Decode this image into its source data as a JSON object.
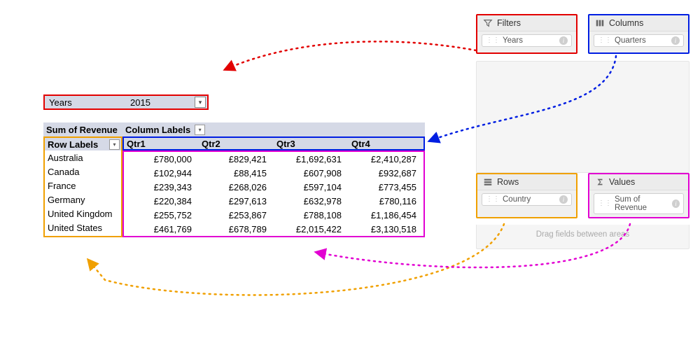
{
  "panels": {
    "filters": {
      "title": "Filters",
      "field": "Years"
    },
    "columns": {
      "title": "Columns",
      "field": "Quarters"
    },
    "rows": {
      "title": "Rows",
      "field": "Country"
    },
    "values": {
      "title": "Values",
      "field": "Sum of Revenue"
    },
    "hint": "Drag fields between areas"
  },
  "filter_bar": {
    "label": "Years",
    "value": "2015"
  },
  "pivot": {
    "measure_label": "Sum of Revenue",
    "col_labels_caption": "Column Labels",
    "row_labels_caption": "Row Labels",
    "columns": [
      "Qtr1",
      "Qtr2",
      "Qtr3",
      "Qtr4"
    ],
    "rows": [
      {
        "name": "Australia",
        "values": [
          "£780,000",
          "£829,421",
          "£1,692,631",
          "£2,410,287"
        ]
      },
      {
        "name": "Canada",
        "values": [
          "£102,944",
          "£88,415",
          "£607,908",
          "£932,687"
        ]
      },
      {
        "name": "France",
        "values": [
          "£239,343",
          "£268,026",
          "£597,104",
          "£773,455"
        ]
      },
      {
        "name": "Germany",
        "values": [
          "£220,384",
          "£297,613",
          "£632,978",
          "£780,116"
        ]
      },
      {
        "name": "United Kingdom",
        "values": [
          "£255,752",
          "£253,867",
          "£788,108",
          "£1,186,454"
        ]
      },
      {
        "name": "United States",
        "values": [
          "£461,769",
          "£678,789",
          "£2,015,422",
          "£3,130,518"
        ]
      }
    ]
  },
  "chart_data": {
    "type": "table",
    "title": "Sum of Revenue by Country and Quarter, 2015 (GBP)",
    "columns": [
      "Country",
      "Qtr1",
      "Qtr2",
      "Qtr3",
      "Qtr4"
    ],
    "rows": [
      [
        "Australia",
        780000,
        829421,
        1692631,
        2410287
      ],
      [
        "Canada",
        102944,
        88415,
        607908,
        932687
      ],
      [
        "France",
        239343,
        268026,
        597104,
        773455
      ],
      [
        "Germany",
        220384,
        297613,
        632978,
        780116
      ],
      [
        "United Kingdom",
        255752,
        253867,
        788108,
        1186454
      ],
      [
        "United States",
        461769,
        678789,
        2015422,
        3130518
      ]
    ],
    "filter": {
      "Years": 2015
    },
    "currency": "GBP"
  }
}
